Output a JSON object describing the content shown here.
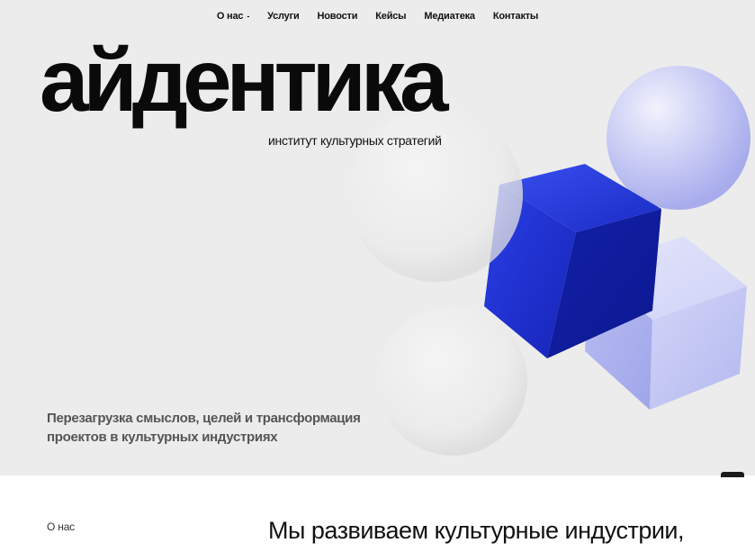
{
  "nav": {
    "items": [
      {
        "label": "О нас",
        "has_dropdown": true
      },
      {
        "label": "Услуги"
      },
      {
        "label": "Новости"
      },
      {
        "label": "Кейсы"
      },
      {
        "label": "Медиатека"
      },
      {
        "label": "Контакты"
      }
    ],
    "dropdown_glyph": "-"
  },
  "hero": {
    "logo": "айдентика",
    "subtitle": "институт культурных стратегий",
    "tagline_line1": "Перезагрузка смыслов, целей и трансформация",
    "tagline_line2": "проектов в культурных индустриях",
    "background": "#ececec",
    "accent_blue": "#1a2fd6",
    "accent_lavender": "#c9ccf4"
  },
  "about": {
    "label": "О нас",
    "heading_line1": "Мы развиваем культурные индустрии,"
  }
}
